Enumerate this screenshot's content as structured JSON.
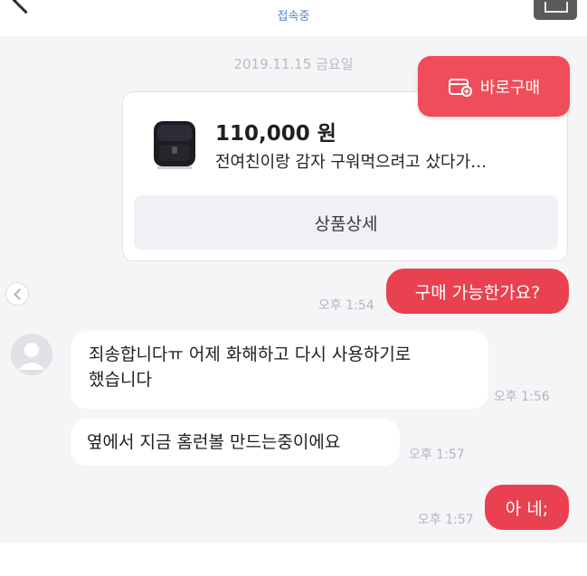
{
  "header": {
    "status": "접속중"
  },
  "chat": {
    "date": "2019.11.15 금요일",
    "product": {
      "price": "110,000 원",
      "title": "전여친이랑 감자 구워먹으려고 샀다가…",
      "detail_label": "상품상세"
    },
    "buy_now_label": "바로구매",
    "messages": [
      {
        "from": "me",
        "text": "구매 가능한가요?",
        "time": "오후 1:54"
      },
      {
        "from": "other",
        "line1": "죄송합니다ㅠ 어제 화해하고 다시 사용하기로",
        "line2": "했습니다",
        "time": "오후 1:56"
      },
      {
        "from": "other",
        "text": "옆에서 지금 홈런볼 만드는중이에요",
        "time": "오후 1:57"
      },
      {
        "from": "me",
        "text": "아 네;",
        "time": "오후 1:57"
      }
    ]
  },
  "colors": {
    "accent": "#e9414f",
    "status_blue": "#5b7fd6",
    "chat_bg": "#f5f5f8"
  },
  "icons": [
    "back-chevron-icon",
    "expand-icon",
    "receipt-icon",
    "left-arrow-icon",
    "air-fryer-image",
    "avatar-person-icon"
  ]
}
